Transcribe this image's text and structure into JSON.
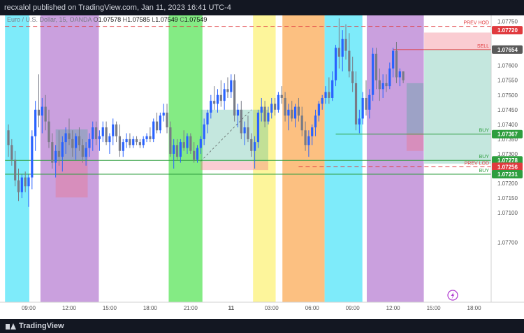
{
  "header": {
    "publisher_text": "recxalol published on TradingView.com, Jan 11, 2023 16:41 UTC-4"
  },
  "legend": {
    "symbol": "Euro / U.S. Dollar, 15, OANDA",
    "open_label": "O",
    "open": "1.07578",
    "high_label": "H",
    "high": "1.07585",
    "low_label": "L",
    "low": "1.07549",
    "close_label": "C",
    "close": "1.07549"
  },
  "footer": {
    "brand": "TradingView"
  },
  "colors": {
    "up": "#2962ff",
    "down": "#787b86",
    "bg": "#ffffff",
    "cyan_session": "#67e8f9",
    "purple_session": "#c18fd8",
    "green_session": "#6ee86e",
    "yellow_session": "#fdf38a",
    "orange_session": "#fbb56b",
    "level_green": "#2e9e3e",
    "level_red": "#e03a3e"
  },
  "chart_data": {
    "type": "candlestick",
    "symbol": "EURUSD",
    "timeframe": "15",
    "ylim": [
      1.0707,
      1.0776
    ],
    "y_ticks": [
      {
        "value": 1.0775,
        "label": "1.07750"
      },
      {
        "value": 1.07,
        "label": "1.07700"
      },
      {
        "value": 1.0765,
        "label": "1.07650"
      },
      {
        "value": 1.076,
        "label": "1.07600"
      },
      {
        "value": 1.0755,
        "label": "1.07550"
      },
      {
        "value": 1.075,
        "label": "1.07500"
      },
      {
        "value": 1.0745,
        "label": "1.07450"
      },
      {
        "value": 1.074,
        "label": "1.07400"
      },
      {
        "value": 1.0735,
        "label": "1.07350"
      },
      {
        "value": 1.073,
        "label": "1.07300"
      },
      {
        "value": 1.0725,
        "label": "1.07250"
      },
      {
        "value": 1.072,
        "label": "1.07200"
      },
      {
        "value": 1.0715,
        "label": "1.07150"
      },
      {
        "value": 1.071,
        "label": "1.07100"
      }
    ],
    "x_ticks": [
      {
        "t": 0,
        "label": "09:00"
      },
      {
        "t": 12,
        "label": "12:00"
      },
      {
        "t": 24,
        "label": "15:00"
      },
      {
        "t": 36,
        "label": "18:00"
      },
      {
        "t": 48,
        "label": "21:00"
      },
      {
        "t": 60,
        "label": "11"
      },
      {
        "t": 72,
        "label": "03:00"
      },
      {
        "t": 84,
        "label": "06:00"
      },
      {
        "t": 96,
        "label": "09:00"
      },
      {
        "t": 108,
        "label": "12:00"
      },
      {
        "t": 120,
        "label": "15:00"
      },
      {
        "t": 132,
        "label": "18:00"
      }
    ],
    "sessions": [
      {
        "start": -7,
        "end": 0.2,
        "color": "cyan_session"
      },
      {
        "start": 3.5,
        "end": 20.8,
        "color": "purple_session"
      },
      {
        "start": 41.5,
        "end": 51.5,
        "color": "green_session"
      },
      {
        "start": 66.5,
        "end": 73.2,
        "color": "yellow_session"
      },
      {
        "start": 75.2,
        "end": 87.7,
        "color": "orange_session"
      },
      {
        "start": 87.7,
        "end": 98.9,
        "color": "cyan_session"
      },
      {
        "start": 100.2,
        "end": 117.1,
        "color": "purple_session"
      }
    ],
    "levels": [
      {
        "price": 1.07733,
        "label": "PREV HOD",
        "badge": "1.07720",
        "badge_price": 1.0772,
        "color": "level_red",
        "style": "dashed",
        "x_start": -7
      },
      {
        "price": 1.07654,
        "label": "SELL",
        "badge": "1.07654",
        "badge_price": 1.07654,
        "color": "level_red",
        "style": "solid",
        "x_start": 108,
        "badge_dark": true
      },
      {
        "price": 1.07367,
        "label": "BUY",
        "badge": "1.07367",
        "badge_price": 1.07367,
        "color": "level_green",
        "style": "solid",
        "x_start": 91
      },
      {
        "price": 1.07278,
        "label": "BUY",
        "badge": "1.07278",
        "badge_price": 1.07278,
        "color": "level_green",
        "style": "solid",
        "x_start": -7
      },
      {
        "price": 1.07256,
        "label": "PREV LOD",
        "badge": "1.07256",
        "badge_price": 1.07256,
        "color": "level_red",
        "style": "dashed",
        "x_start": 80
      },
      {
        "price": 1.07231,
        "label": "BUY",
        "badge": "1.07231",
        "badge_price": 1.07231,
        "color": "level_green",
        "style": "solid",
        "x_start": -7
      }
    ],
    "positions": [
      {
        "x0": 8,
        "x1": 17.5,
        "entry": 1.07278,
        "target": 1.07383,
        "stop": 1.07152
      },
      {
        "x0": 51,
        "x1": 71,
        "entry": 1.07275,
        "target": 1.0745,
        "stop": 1.07245,
        "active_to": 66
      },
      {
        "x0": 117.2,
        "x1": 139,
        "entry": 1.07654,
        "target": 1.07267,
        "stop": 1.07712
      },
      {
        "x0": 112,
        "x1": 117,
        "entry": 1.0737,
        "target": 1.0754,
        "stop": 1.0731
      }
    ],
    "candles": [
      {
        "o": 1.0738,
        "h": 1.074,
        "l": 1.0729,
        "c": 1.0733
      },
      {
        "o": 1.0733,
        "h": 1.0735,
        "l": 1.0726,
        "c": 1.0728
      },
      {
        "o": 1.0728,
        "h": 1.0731,
        "l": 1.0719,
        "c": 1.0721
      },
      {
        "o": 1.0721,
        "h": 1.0725,
        "l": 1.0714,
        "c": 1.0717
      },
      {
        "o": 1.0717,
        "h": 1.0723,
        "l": 1.0715,
        "c": 1.0722
      },
      {
        "o": 1.0722,
        "h": 1.0724,
        "l": 1.0717,
        "c": 1.0719
      },
      {
        "o": 1.0719,
        "h": 1.0723,
        "l": 1.0712,
        "c": 1.0722
      },
      {
        "o": 1.0722,
        "h": 1.0738,
        "l": 1.0718,
        "c": 1.0736
      },
      {
        "o": 1.0736,
        "h": 1.0748,
        "l": 1.0731,
        "c": 1.0745
      },
      {
        "o": 1.0745,
        "h": 1.0757,
        "l": 1.0739,
        "c": 1.0743
      },
      {
        "o": 1.0743,
        "h": 1.0749,
        "l": 1.0737,
        "c": 1.0746
      },
      {
        "o": 1.0746,
        "h": 1.075,
        "l": 1.0738,
        "c": 1.0741
      },
      {
        "o": 1.0741,
        "h": 1.0745,
        "l": 1.0732,
        "c": 1.0734
      },
      {
        "o": 1.0734,
        "h": 1.0737,
        "l": 1.0725,
        "c": 1.0727
      },
      {
        "o": 1.0727,
        "h": 1.0733,
        "l": 1.0722,
        "c": 1.0731
      },
      {
        "o": 1.0731,
        "h": 1.0738,
        "l": 1.0726,
        "c": 1.0729
      },
      {
        "o": 1.0729,
        "h": 1.0736,
        "l": 1.0724,
        "c": 1.0734
      },
      {
        "o": 1.0734,
        "h": 1.0739,
        "l": 1.073,
        "c": 1.0737
      },
      {
        "o": 1.0737,
        "h": 1.0742,
        "l": 1.0733,
        "c": 1.0735
      },
      {
        "o": 1.0735,
        "h": 1.0738,
        "l": 1.0729,
        "c": 1.0732
      },
      {
        "o": 1.0732,
        "h": 1.0737,
        "l": 1.0728,
        "c": 1.0736
      },
      {
        "o": 1.0736,
        "h": 1.0739,
        "l": 1.0731,
        "c": 1.0733
      },
      {
        "o": 1.0733,
        "h": 1.0735,
        "l": 1.0727,
        "c": 1.0729
      },
      {
        "o": 1.0729,
        "h": 1.0734,
        "l": 1.0726,
        "c": 1.0732
      },
      {
        "o": 1.0732,
        "h": 1.0737,
        "l": 1.0729,
        "c": 1.0735
      },
      {
        "o": 1.0735,
        "h": 1.0741,
        "l": 1.0731,
        "c": 1.0739
      },
      {
        "o": 1.0739,
        "h": 1.0741,
        "l": 1.0733,
        "c": 1.0735
      },
      {
        "o": 1.0735,
        "h": 1.0738,
        "l": 1.0731,
        "c": 1.0736
      },
      {
        "o": 1.0736,
        "h": 1.0741,
        "l": 1.0734,
        "c": 1.0739
      },
      {
        "o": 1.0739,
        "h": 1.0741,
        "l": 1.0733,
        "c": 1.0734
      },
      {
        "o": 1.0734,
        "h": 1.0737,
        "l": 1.073,
        "c": 1.0736
      },
      {
        "o": 1.0736,
        "h": 1.0742,
        "l": 1.0733,
        "c": 1.074
      },
      {
        "o": 1.074,
        "h": 1.0741,
        "l": 1.0734,
        "c": 1.0736
      },
      {
        "o": 1.0736,
        "h": 1.074,
        "l": 1.0729,
        "c": 1.0731
      },
      {
        "o": 1.0731,
        "h": 1.0735,
        "l": 1.0729,
        "c": 1.0734
      },
      {
        "o": 1.0734,
        "h": 1.0737,
        "l": 1.0732,
        "c": 1.0735
      },
      {
        "o": 1.0735,
        "h": 1.0737,
        "l": 1.0732,
        "c": 1.0733
      },
      {
        "o": 1.0733,
        "h": 1.0736,
        "l": 1.0732,
        "c": 1.0735
      },
      {
        "o": 1.0735,
        "h": 1.0736,
        "l": 1.0733,
        "c": 1.0734
      },
      {
        "o": 1.0734,
        "h": 1.0735,
        "l": 1.0732,
        "c": 1.0733
      },
      {
        "o": 1.0733,
        "h": 1.0736,
        "l": 1.0732,
        "c": 1.0735
      },
      {
        "o": 1.0735,
        "h": 1.0737,
        "l": 1.0734,
        "c": 1.0736
      },
      {
        "o": 1.0736,
        "h": 1.0739,
        "l": 1.0734,
        "c": 1.0735
      },
      {
        "o": 1.0735,
        "h": 1.0742,
        "l": 1.0734,
        "c": 1.0741
      },
      {
        "o": 1.0741,
        "h": 1.0744,
        "l": 1.0737,
        "c": 1.0738
      },
      {
        "o": 1.0738,
        "h": 1.0744,
        "l": 1.0737,
        "c": 1.0743
      },
      {
        "o": 1.0743,
        "h": 1.0747,
        "l": 1.0741,
        "c": 1.0744
      },
      {
        "o": 1.0744,
        "h": 1.0747,
        "l": 1.0737,
        "c": 1.0739
      },
      {
        "o": 1.0739,
        "h": 1.0741,
        "l": 1.0729,
        "c": 1.073
      },
      {
        "o": 1.073,
        "h": 1.0735,
        "l": 1.0725,
        "c": 1.0733
      },
      {
        "o": 1.0733,
        "h": 1.0735,
        "l": 1.0728,
        "c": 1.0729
      },
      {
        "o": 1.0729,
        "h": 1.0735,
        "l": 1.0727,
        "c": 1.0734
      },
      {
        "o": 1.0734,
        "h": 1.0738,
        "l": 1.0731,
        "c": 1.0732
      },
      {
        "o": 1.0732,
        "h": 1.0737,
        "l": 1.073,
        "c": 1.0736
      },
      {
        "o": 1.0736,
        "h": 1.0737,
        "l": 1.073,
        "c": 1.0731
      },
      {
        "o": 1.0731,
        "h": 1.0734,
        "l": 1.0727,
        "c": 1.0728
      },
      {
        "o": 1.0728,
        "h": 1.0733,
        "l": 1.0727,
        "c": 1.0732
      },
      {
        "o": 1.0732,
        "h": 1.0736,
        "l": 1.073,
        "c": 1.0735
      },
      {
        "o": 1.0735,
        "h": 1.0742,
        "l": 1.0733,
        "c": 1.074
      },
      {
        "o": 1.074,
        "h": 1.0745,
        "l": 1.0737,
        "c": 1.0744
      },
      {
        "o": 1.0744,
        "h": 1.075,
        "l": 1.0742,
        "c": 1.0748
      },
      {
        "o": 1.0748,
        "h": 1.0753,
        "l": 1.0745,
        "c": 1.0747
      },
      {
        "o": 1.0747,
        "h": 1.0752,
        "l": 1.0744,
        "c": 1.075
      },
      {
        "o": 1.075,
        "h": 1.0755,
        "l": 1.0746,
        "c": 1.0748
      },
      {
        "o": 1.0748,
        "h": 1.0754,
        "l": 1.0745,
        "c": 1.0752
      },
      {
        "o": 1.0752,
        "h": 1.0756,
        "l": 1.0749,
        "c": 1.0751
      },
      {
        "o": 1.0751,
        "h": 1.0757,
        "l": 1.0749,
        "c": 1.0755
      },
      {
        "o": 1.0755,
        "h": 1.0757,
        "l": 1.0741,
        "c": 1.0743
      },
      {
        "o": 1.0743,
        "h": 1.0747,
        "l": 1.0739,
        "c": 1.0745
      },
      {
        "o": 1.0745,
        "h": 1.0748,
        "l": 1.0735,
        "c": 1.0737
      },
      {
        "o": 1.0737,
        "h": 1.0741,
        "l": 1.0733,
        "c": 1.0739
      },
      {
        "o": 1.0739,
        "h": 1.0743,
        "l": 1.0734,
        "c": 1.0735
      },
      {
        "o": 1.0735,
        "h": 1.0737,
        "l": 1.0729,
        "c": 1.0731
      },
      {
        "o": 1.0731,
        "h": 1.0736,
        "l": 1.0725,
        "c": 1.0734
      },
      {
        "o": 1.0734,
        "h": 1.0745,
        "l": 1.0732,
        "c": 1.0744
      },
      {
        "o": 1.0744,
        "h": 1.0749,
        "l": 1.0741,
        "c": 1.0746
      },
      {
        "o": 1.0746,
        "h": 1.0748,
        "l": 1.0739,
        "c": 1.0741
      },
      {
        "o": 1.0741,
        "h": 1.0746,
        "l": 1.074,
        "c": 1.0744
      },
      {
        "o": 1.0744,
        "h": 1.0749,
        "l": 1.0742,
        "c": 1.0747
      },
      {
        "o": 1.0747,
        "h": 1.0749,
        "l": 1.0743,
        "c": 1.0745
      },
      {
        "o": 1.0745,
        "h": 1.0751,
        "l": 1.0744,
        "c": 1.075
      },
      {
        "o": 1.075,
        "h": 1.0753,
        "l": 1.0747,
        "c": 1.0749
      },
      {
        "o": 1.0749,
        "h": 1.0751,
        "l": 1.0741,
        "c": 1.0743
      },
      {
        "o": 1.0743,
        "h": 1.0747,
        "l": 1.0738,
        "c": 1.0745
      },
      {
        "o": 1.0745,
        "h": 1.0748,
        "l": 1.0741,
        "c": 1.0742
      },
      {
        "o": 1.0742,
        "h": 1.0747,
        "l": 1.0739,
        "c": 1.0746
      },
      {
        "o": 1.0746,
        "h": 1.0749,
        "l": 1.0741,
        "c": 1.0743
      },
      {
        "o": 1.0743,
        "h": 1.0746,
        "l": 1.0736,
        "c": 1.0738
      },
      {
        "o": 1.0738,
        "h": 1.0741,
        "l": 1.0731,
        "c": 1.0733
      },
      {
        "o": 1.0733,
        "h": 1.0738,
        "l": 1.0729,
        "c": 1.0736
      },
      {
        "o": 1.0736,
        "h": 1.074,
        "l": 1.0733,
        "c": 1.0739
      },
      {
        "o": 1.0739,
        "h": 1.0745,
        "l": 1.0736,
        "c": 1.0743
      },
      {
        "o": 1.0743,
        "h": 1.0748,
        "l": 1.0741,
        "c": 1.0747
      },
      {
        "o": 1.0747,
        "h": 1.075,
        "l": 1.0745,
        "c": 1.0749
      },
      {
        "o": 1.0749,
        "h": 1.0753,
        "l": 1.0747,
        "c": 1.0751
      },
      {
        "o": 1.0751,
        "h": 1.0756,
        "l": 1.0747,
        "c": 1.0749
      },
      {
        "o": 1.0749,
        "h": 1.0758,
        "l": 1.0748,
        "c": 1.0755
      },
      {
        "o": 1.0755,
        "h": 1.0767,
        "l": 1.0753,
        "c": 1.0766
      },
      {
        "o": 1.0766,
        "h": 1.0776,
        "l": 1.0759,
        "c": 1.0763
      },
      {
        "o": 1.0763,
        "h": 1.0772,
        "l": 1.0758,
        "c": 1.0769
      },
      {
        "o": 1.0769,
        "h": 1.0774,
        "l": 1.0762,
        "c": 1.0765
      },
      {
        "o": 1.0765,
        "h": 1.0771,
        "l": 1.0756,
        "c": 1.0758
      },
      {
        "o": 1.0758,
        "h": 1.0763,
        "l": 1.0751,
        "c": 1.0754
      },
      {
        "o": 1.0754,
        "h": 1.0758,
        "l": 1.0738,
        "c": 1.074
      },
      {
        "o": 1.074,
        "h": 1.0745,
        "l": 1.0737,
        "c": 1.0742
      },
      {
        "o": 1.0742,
        "h": 1.0751,
        "l": 1.074,
        "c": 1.0749
      },
      {
        "o": 1.0749,
        "h": 1.0755,
        "l": 1.0743,
        "c": 1.0745
      },
      {
        "o": 1.0745,
        "h": 1.0752,
        "l": 1.0742,
        "c": 1.075
      },
      {
        "o": 1.075,
        "h": 1.0766,
        "l": 1.0748,
        "c": 1.0764
      },
      {
        "o": 1.0764,
        "h": 1.0766,
        "l": 1.0752,
        "c": 1.0755
      },
      {
        "o": 1.0755,
        "h": 1.0759,
        "l": 1.0748,
        "c": 1.0752
      },
      {
        "o": 1.0752,
        "h": 1.0757,
        "l": 1.0749,
        "c": 1.0754
      },
      {
        "o": 1.0754,
        "h": 1.0757,
        "l": 1.0751,
        "c": 1.0753
      },
      {
        "o": 1.0753,
        "h": 1.0761,
        "l": 1.0752,
        "c": 1.0759
      },
      {
        "o": 1.0759,
        "h": 1.0766,
        "l": 1.0756,
        "c": 1.0765
      },
      {
        "o": 1.0765,
        "h": 1.0768,
        "l": 1.0754,
        "c": 1.0756
      },
      {
        "o": 1.0756,
        "h": 1.0759,
        "l": 1.0753,
        "c": 1.0758
      },
      {
        "o": 1.0758,
        "h": 1.0758,
        "l": 1.0754,
        "c": 1.0755
      }
    ]
  }
}
